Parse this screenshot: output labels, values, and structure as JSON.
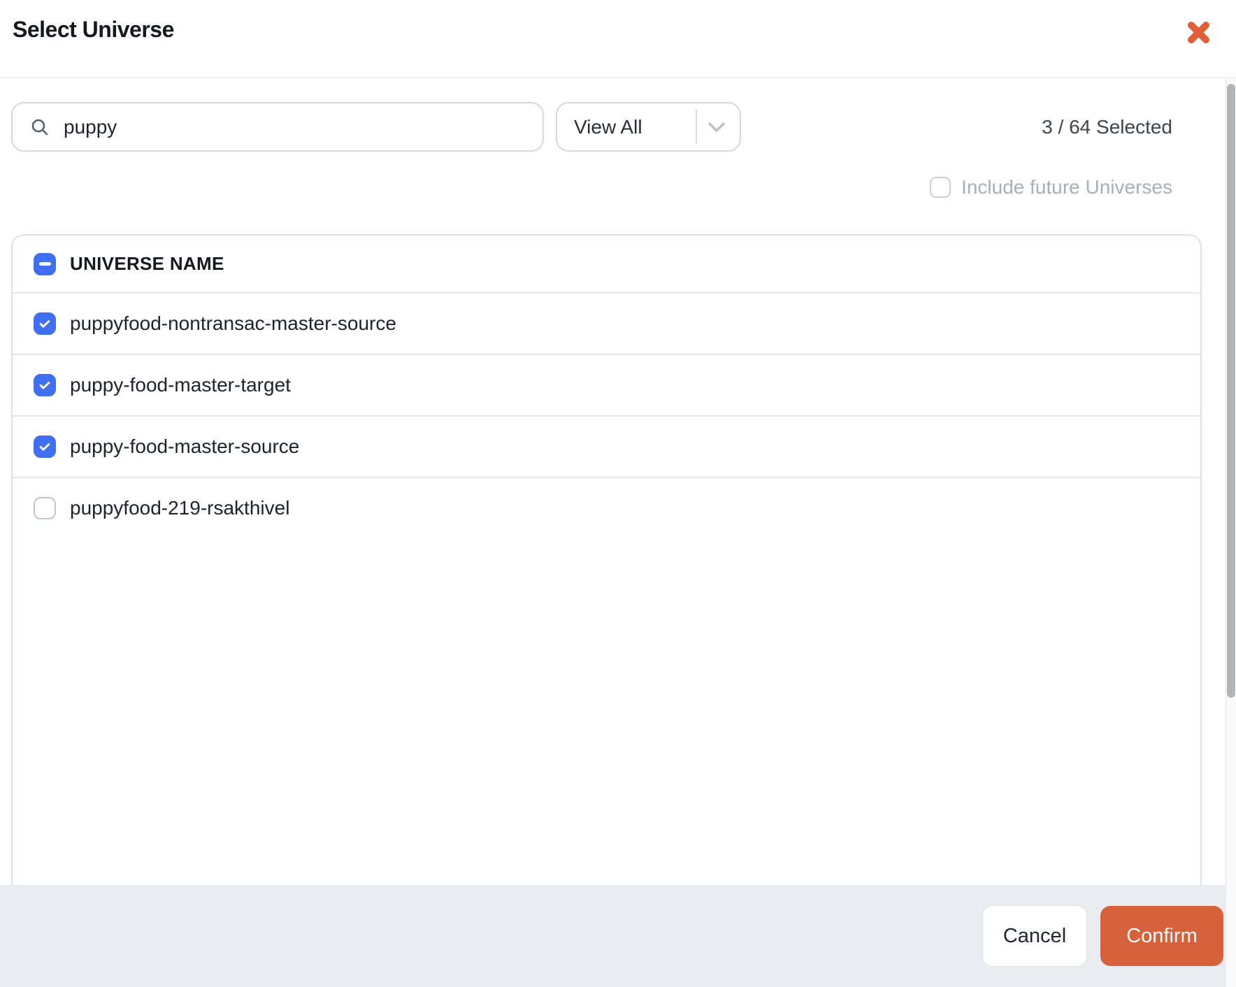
{
  "modal": {
    "title": "Select Universe"
  },
  "toolbar": {
    "search": {
      "value": "puppy",
      "icon": "magnifier"
    },
    "view_filter": {
      "value": "View All",
      "icon": "chevron-down"
    },
    "selection_summary": "3 / 64 Selected",
    "include_future": {
      "label": "Include future Universes",
      "checked": false
    }
  },
  "table": {
    "header": {
      "name_column": "UNIVERSE NAME",
      "select_all_state": "indeterminate"
    },
    "rows": [
      {
        "name": "puppyfood-nontransac-master-source",
        "checked": true
      },
      {
        "name": "puppy-food-master-target",
        "checked": true
      },
      {
        "name": "puppy-food-master-source",
        "checked": true
      },
      {
        "name": "puppyfood-219-rsakthivel",
        "checked": false
      }
    ]
  },
  "footer": {
    "cancel_label": "Cancel",
    "confirm_label": "Confirm"
  },
  "colors": {
    "accent_orange": "#D7613B",
    "accent_blue": "#3F6FF2",
    "footer_bg": "#E9EDF2"
  }
}
